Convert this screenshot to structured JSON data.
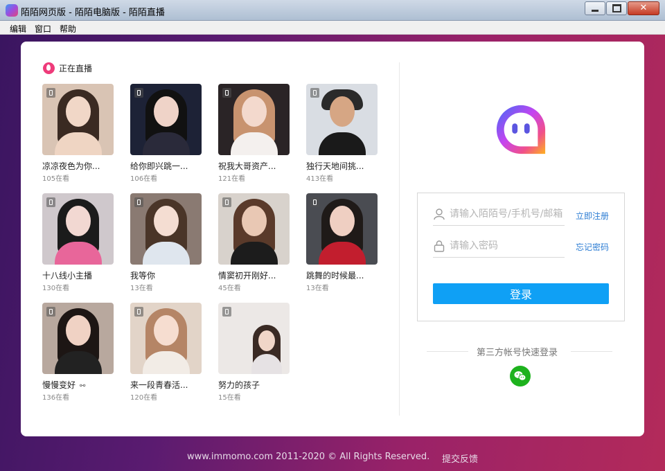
{
  "window": {
    "title": "陌陌网页版 - 陌陌电脑版 - 陌陌直播"
  },
  "menubar": {
    "items": [
      "编辑",
      "窗口",
      "帮助"
    ]
  },
  "live": {
    "title": "正在直播",
    "items": [
      {
        "name": "凉凉夜色为你...",
        "count": "105在看"
      },
      {
        "name": "给你即兴跳一...",
        "count": "106在看"
      },
      {
        "name": "祝我大哥资产...",
        "count": "121在看"
      },
      {
        "name": "独行天地间挑...",
        "count": "413在看"
      },
      {
        "name": "十八线小主播",
        "count": "130在看"
      },
      {
        "name": "我等你",
        "count": "13在看"
      },
      {
        "name": "情窦初开刚好...",
        "count": "45在看"
      },
      {
        "name": "跳舞的时候最...",
        "count": "13在看"
      },
      {
        "name": "慢慢变好",
        "count": "136在看"
      },
      {
        "name": "来一段青春活...",
        "count": "120在看"
      },
      {
        "name": "努力的孩子",
        "count": "15在看"
      }
    ]
  },
  "login": {
    "account_placeholder": "请输入陌陌号/手机号/邮箱",
    "password_placeholder": "请输入密码",
    "register_link": "立即注册",
    "forgot_link": "忘记密码",
    "login_button": "登录",
    "third_party_label": "第三方帐号快速登录"
  },
  "footer": {
    "copyright": "www.immomo.com 2011-2020 © All Rights Reserved.",
    "feedback": "提交反馈"
  },
  "colors": {
    "accent": "#0fa0f5",
    "live": "#ee3b7a",
    "wechat": "#1db21d",
    "link": "#2b7cd3"
  }
}
